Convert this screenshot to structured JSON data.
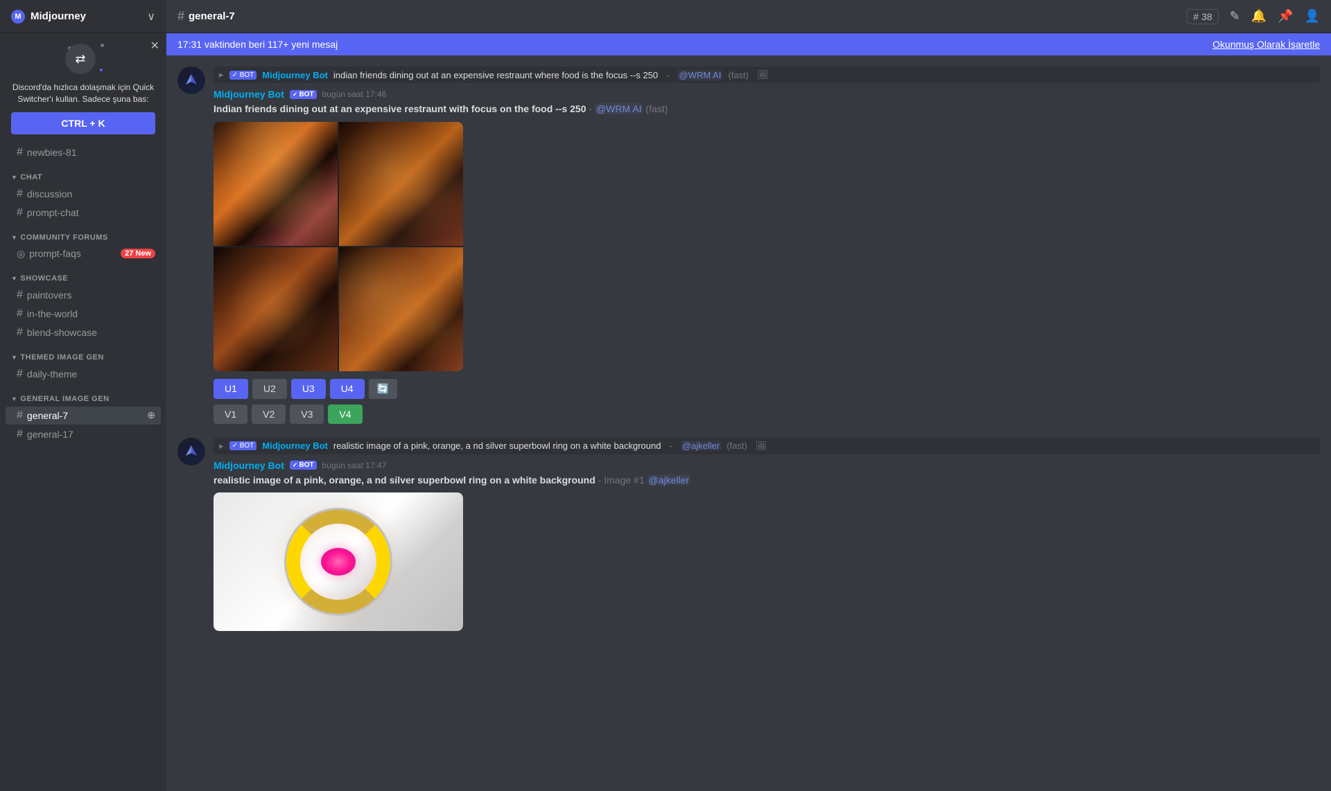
{
  "app": {
    "server_name": "Midjourney",
    "channel_name": "general-7",
    "hash_symbol": "#"
  },
  "header": {
    "channel_name": "general-7",
    "member_count": "38",
    "icons": [
      "threads-icon",
      "bell-icon",
      "pin-icon",
      "member-icon"
    ]
  },
  "banner": {
    "text": "17:31 vaktinden beri 117+ yeni mesaj",
    "action": "Okunmuş Olarak İşaretle"
  },
  "tooltip": {
    "title": "Discord'da hızlıca dolaşmak için Quick Switcher'ı kullan. Sadece şuna bas:",
    "shortcut": "CTRL + K",
    "close": "✕"
  },
  "sidebar": {
    "categories": [
      {
        "name": "CHAT",
        "channels": [
          {
            "id": "discussion",
            "name": "discussion",
            "type": "text"
          },
          {
            "id": "prompt-chat",
            "name": "prompt-chat",
            "type": "text"
          }
        ]
      },
      {
        "name": "COMMUNiTY FORUMS",
        "channels": [
          {
            "id": "prompt-faqs",
            "name": "prompt-faqs",
            "type": "forum",
            "badge": "27 New"
          }
        ]
      },
      {
        "name": "SHOWCASE",
        "channels": [
          {
            "id": "paintovers",
            "name": "paintovers",
            "type": "text"
          },
          {
            "id": "in-the-world",
            "name": "in-the-world",
            "type": "text"
          },
          {
            "id": "blend-showcase",
            "name": "blend-showcase",
            "type": "text"
          }
        ]
      },
      {
        "name": "THEMED IMAGE GEN",
        "channels": [
          {
            "id": "daily-theme",
            "name": "daily-theme",
            "type": "text"
          }
        ]
      },
      {
        "name": "GENERAL IMAGE GEN",
        "channels": [
          {
            "id": "general-7",
            "name": "general-7",
            "type": "text",
            "active": true,
            "add_icon": true
          },
          {
            "id": "general-17",
            "name": "general-17",
            "type": "text"
          }
        ]
      }
    ],
    "above_channels": [
      {
        "id": "newbies-81",
        "name": "newbies-81",
        "type": "text"
      }
    ]
  },
  "messages": [
    {
      "id": "msg-1",
      "type": "command_ref",
      "bot_name": "Midjourney Bot",
      "command_text": "indian friends dining out at an expensive restraunt where food is the focus --s 250",
      "mention": "@WRM AI",
      "speed": "fast"
    },
    {
      "id": "msg-2",
      "username": "Midjourney Bot",
      "timestamp": "bugün saat 17:46",
      "text_bold": "Indian friends dining out at an expensive restraunt with focus on the food --s 250",
      "text_suffix": "@WRM AI",
      "mention": "@WRM AI",
      "speed": "fast",
      "has_image": true,
      "image_type": "dining",
      "buttons": {
        "row1": [
          "U1",
          "U2",
          "U3",
          "U4"
        ],
        "row2": [
          "V1",
          "V2",
          "V3",
          "V4"
        ],
        "active_row1": [
          0,
          2,
          3
        ],
        "active_row2": [
          3
        ],
        "refresh": true
      }
    },
    {
      "id": "msg-3",
      "type": "command_ref",
      "bot_name": "Midjourney Bot",
      "command_text": "realistic image of a pink, orange, a nd silver superbowl ring on a white background",
      "mention": "@ajkeller",
      "speed": "fast"
    },
    {
      "id": "msg-4",
      "username": "Midjourney Bot",
      "timestamp": "bugün saat 17:47",
      "text_bold": "realistic image of a pink, orange, a nd silver superbowl ring on a white background",
      "text_suffix": "- Image #1",
      "mention": "@ajkeller",
      "has_image": true,
      "image_type": "ring"
    }
  ],
  "buttons": {
    "u1": "U1",
    "u2": "U2",
    "u3": "U3",
    "u4": "U4",
    "v1": "V1",
    "v2": "V2",
    "v3": "V3",
    "v4": "V4"
  }
}
